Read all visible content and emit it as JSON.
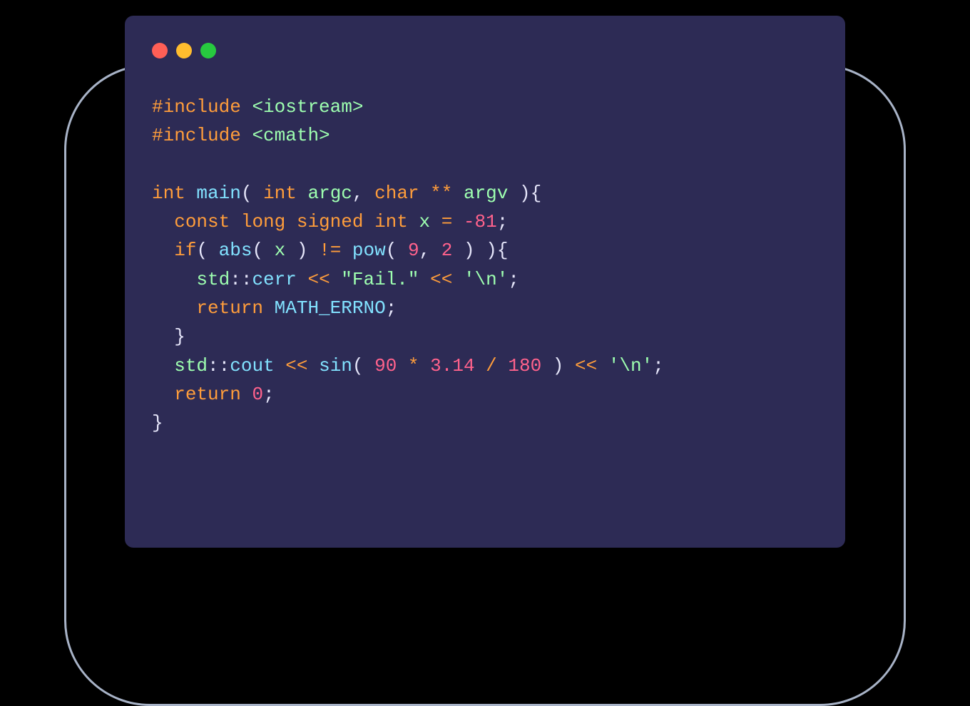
{
  "window": {
    "lights": [
      "red",
      "yellow",
      "green"
    ]
  },
  "code": {
    "inc1_kw": "#include",
    "inc1_hdr": "<iostream>",
    "inc2_kw": "#include",
    "inc2_hdr": "<cmath>",
    "ret_int": "int",
    "main": "main",
    "open_paren": "( ",
    "param_int": "int",
    "sp": " ",
    "argc": "argc",
    "comma": ", ",
    "param_char": "char",
    "stars": " ** ",
    "argv": "argv",
    "close_paren_brace": " ){",
    "indent2": "  ",
    "indent4": "    ",
    "const_kw": "const",
    "long_kw": " long signed int ",
    "x_var": "x",
    "eq": " = ",
    "neg81": "-81",
    "semi": ";",
    "if_kw": "if",
    "abs_fn": "abs",
    "x_ref": " x ",
    "close_p": ")",
    "neq": " != ",
    "pow_fn": "pow",
    "nine": " 9",
    "two": "2",
    "brace_close_open": " ){",
    "std": "std",
    "dcolon": "::",
    "cerr": "cerr",
    "lsh": " << ",
    "fail_str": "\"Fail.\"",
    "nl_char": "'\\n'",
    "return_kw": "return",
    "math_errno": " MATH_ERRNO",
    "rbrace": "}",
    "cout": "cout",
    "sin_fn": "sin",
    "ninety": " 90",
    "mul": " * ",
    "pi": "3.14",
    "div": " / ",
    "one80": "180",
    "zero": " 0",
    "open_p": "( "
  }
}
